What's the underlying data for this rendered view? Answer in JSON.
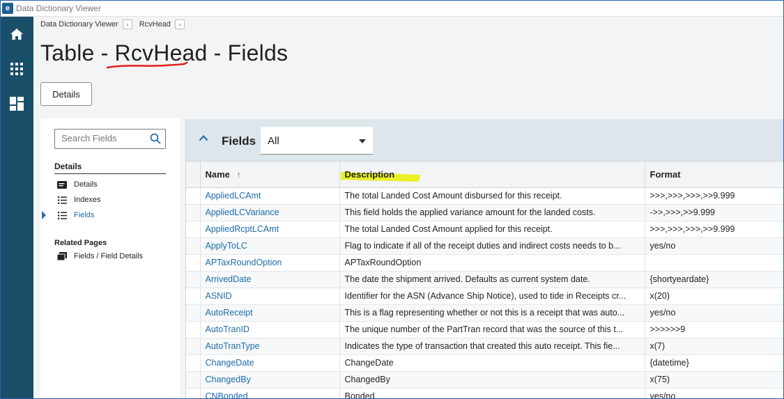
{
  "window": {
    "title": "Data Dictionary Viewer",
    "logo_letter": "e"
  },
  "rail": {
    "icons": [
      "home-icon",
      "apps-grid-icon",
      "dashboard-icon"
    ]
  },
  "breadcrumb": [
    {
      "label": "Data Dictionary Viewer"
    },
    {
      "label": "RcvHead"
    }
  ],
  "page": {
    "title_prefix": "Table - ",
    "title_table": "RcvHead",
    "title_suffix": " - Fields",
    "details_button": "Details"
  },
  "sidebar": {
    "search_placeholder": "Search Fields",
    "section_heading": "Details",
    "items": [
      {
        "label": "Details",
        "icon": "details-card-icon"
      },
      {
        "label": "Indexes",
        "icon": "list-icon"
      },
      {
        "label": "Fields",
        "icon": "list-icon",
        "active": true
      }
    ],
    "related_heading": "Related Pages",
    "related_items": [
      {
        "label": "Fields / Field Details",
        "icon": "window-stack-icon"
      }
    ]
  },
  "grid": {
    "panel_title": "Fields",
    "filter_value": "All",
    "columns": {
      "name": "Name",
      "description": "Description",
      "format": "Format"
    },
    "sort_indicator": "↑",
    "rows": [
      {
        "name": "AppliedLCAmt",
        "description": "The total Landed Cost Amount disbursed for this receipt.",
        "format": ">>>,>>>,>>>,>>9.999"
      },
      {
        "name": "AppliedLCVariance",
        "description": "This field holds the applied variance amount for the landed costs.",
        "format": "->>,>>>,>>9.999"
      },
      {
        "name": "AppliedRcptLCAmt",
        "description": "The total Landed Cost Amount applied for this receipt.",
        "format": ">>>,>>>,>>>,>>9.999"
      },
      {
        "name": "ApplyToLC",
        "description": "Flag to indicate if all of the receipt duties and indirect costs needs to b...",
        "format": "yes/no"
      },
      {
        "name": "APTaxRoundOption",
        "description": "APTaxRoundOption",
        "format": ""
      },
      {
        "name": "ArrivedDate",
        "description": "The date the shipment arrived. Defaults as current system date.",
        "format": "{shortyeardate}"
      },
      {
        "name": "ASNID",
        "description": "Identifier for the ASN (Advance Ship Notice), used to tide in Receipts cr...",
        "format": "x(20)"
      },
      {
        "name": "AutoReceipt",
        "description": "This is a flag representing whether or not this is a receipt that was auto...",
        "format": "yes/no"
      },
      {
        "name": "AutoTranID",
        "description": "The unique number of the PartTran record that was the source of this t...",
        "format": ">>>>>>9"
      },
      {
        "name": "AutoTranType",
        "description": "Indicates the type of transaction that created this auto receipt. This fie...",
        "format": "x(7)"
      },
      {
        "name": "ChangeDate",
        "description": "ChangeDate",
        "format": "{datetime}"
      },
      {
        "name": "ChangedBy",
        "description": "ChangedBy",
        "format": "x(75)"
      },
      {
        "name": "CNBonded",
        "description": "Bonded",
        "format": "yes/no"
      }
    ]
  },
  "colors": {
    "rail": "#1a4f69",
    "link": "#1d6cab",
    "underline_annotation": "#e0201c",
    "highlight_annotation": "#e8f000"
  }
}
